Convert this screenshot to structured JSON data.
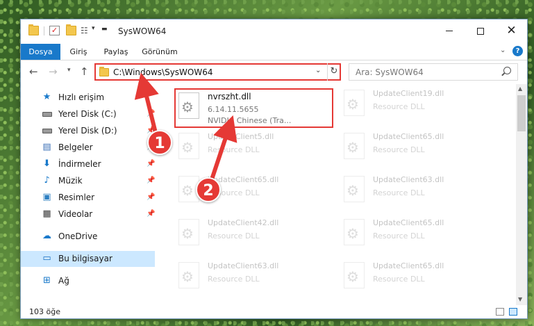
{
  "window": {
    "title": "SysWOW64"
  },
  "ribbon": {
    "tabs": [
      "Dosya",
      "Giriş",
      "Paylaş",
      "Görünüm"
    ],
    "active_tab": "Dosya",
    "help_label": "?"
  },
  "navbar": {
    "address": "C:\\Windows\\SysWOW64",
    "search_placeholder": "Ara: SysWOW64"
  },
  "sidebar": {
    "items": [
      {
        "label": "Hızlı erişim",
        "icon": "star-icon"
      },
      {
        "label": "Yerel Disk (C:)",
        "icon": "drive-icon"
      },
      {
        "label": "Yerel Disk (D:)",
        "icon": "drive-icon"
      },
      {
        "label": "Belgeler",
        "icon": "document-icon"
      },
      {
        "label": "İndirmeler",
        "icon": "download-icon"
      },
      {
        "label": "Müzik",
        "icon": "music-icon"
      },
      {
        "label": "Resimler",
        "icon": "pictures-icon"
      },
      {
        "label": "Videolar",
        "icon": "video-icon"
      },
      {
        "label": "OneDrive",
        "icon": "cloud-icon"
      },
      {
        "label": "Bu bilgisayar",
        "icon": "computer-icon"
      },
      {
        "label": "Ağ",
        "icon": "network-icon"
      }
    ]
  },
  "files": {
    "highlighted": {
      "name": "nvrszht.dll",
      "version": "6.14.11.5655",
      "description": "NVIDIA Chinese (Tra..."
    },
    "faded": [
      {
        "name": "UpdateClient19.dll",
        "type": "Resource DLL"
      },
      {
        "name": "UpdateClient5.dll",
        "type": "Resource DLL"
      },
      {
        "name": "UpdateClient65.dll",
        "type": "Resource DLL"
      },
      {
        "name": "UpdateClient65.dll",
        "type": "Resource DLL"
      },
      {
        "name": "UpdateClient63.dll",
        "type": "Resource DLL"
      },
      {
        "name": "UpdateClient42.dll",
        "type": "Resource DLL"
      },
      {
        "name": "UpdateClient65.dll",
        "type": "Resource DLL"
      },
      {
        "name": "UpdateClient63.dll",
        "type": "Resource DLL"
      },
      {
        "name": "UpdateClient65.dll",
        "type": "Resource DLL"
      }
    ]
  },
  "status": {
    "count": "103 öğe"
  },
  "annotations": {
    "step1": "1",
    "step2": "2",
    "color": "#e53935"
  }
}
